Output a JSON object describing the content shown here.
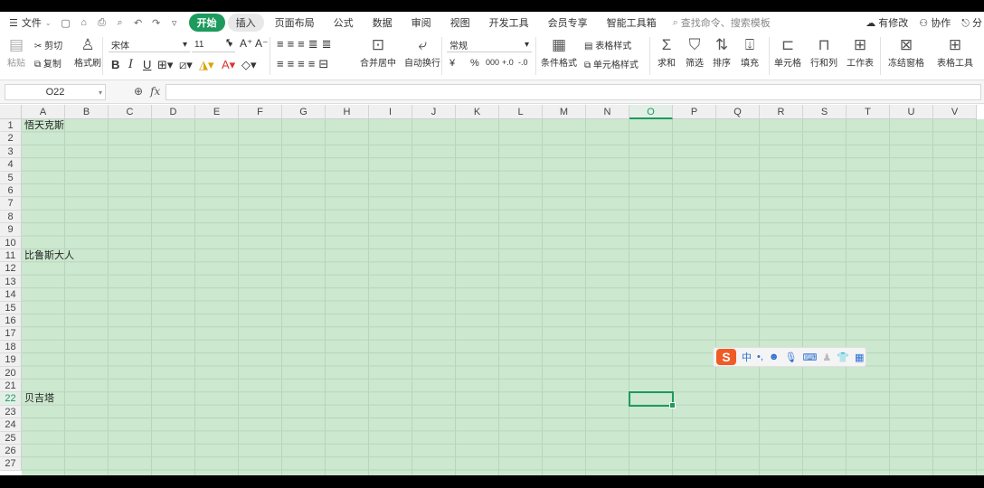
{
  "menubar": {
    "file_label": "文件",
    "tabs": [
      "开始",
      "插入",
      "页面布局",
      "公式",
      "数据",
      "审阅",
      "视图",
      "开发工具",
      "会员专享",
      "智能工具箱"
    ],
    "search_placeholder": "查找命令、搜索模板",
    "right": {
      "unsaved": "有修改",
      "collab": "协作",
      "share": "分"
    }
  },
  "ribbon": {
    "paste": "粘贴",
    "cut": "剪切",
    "copy": "复制",
    "format_painter": "格式刷",
    "font_name": "宋体",
    "font_size": "11",
    "bold": "B",
    "italic": "I",
    "underline": "U",
    "merge": "合并居中",
    "wrap": "自动换行",
    "number_format": "常规",
    "currency": "¥",
    "percent": "%",
    "thousands": "000",
    "inc_decimal": "+.0",
    "dec_decimal": "-.0",
    "cond_format": "条件格式",
    "table_style": "表格样式",
    "cell_style": "单元格样式",
    "sum": "求和",
    "filter": "筛选",
    "sort": "排序",
    "fill": "填充",
    "cells": "单元格",
    "rows_cols": "行和列",
    "worksheet": "工作表",
    "freeze": "冻结窗格",
    "table_tools": "表格工具"
  },
  "formula_bar": {
    "name_box": "O22",
    "fx": "fx",
    "formula": ""
  },
  "grid": {
    "columns": [
      "A",
      "B",
      "C",
      "D",
      "E",
      "F",
      "G",
      "H",
      "I",
      "J",
      "K",
      "L",
      "M",
      "N",
      "O",
      "P",
      "Q",
      "R",
      "S",
      "T",
      "U",
      "V"
    ],
    "rows": [
      "1",
      "2",
      "3",
      "4",
      "5",
      "6",
      "7",
      "8",
      "9",
      "10",
      "11",
      "12",
      "13",
      "14",
      "15",
      "16",
      "17",
      "18",
      "19",
      "20",
      "21",
      "22",
      "23",
      "24",
      "25",
      "26",
      "27"
    ],
    "selected_col": "O",
    "selected_row": "22",
    "cells": {
      "A1": "悟天克斯",
      "A11": "比鲁斯大人",
      "A22": "贝吉塔"
    },
    "background_color": "#cce8cf",
    "accent_color": "#1d9a5d"
  },
  "ime": {
    "logo": "S",
    "mode": "中"
  }
}
